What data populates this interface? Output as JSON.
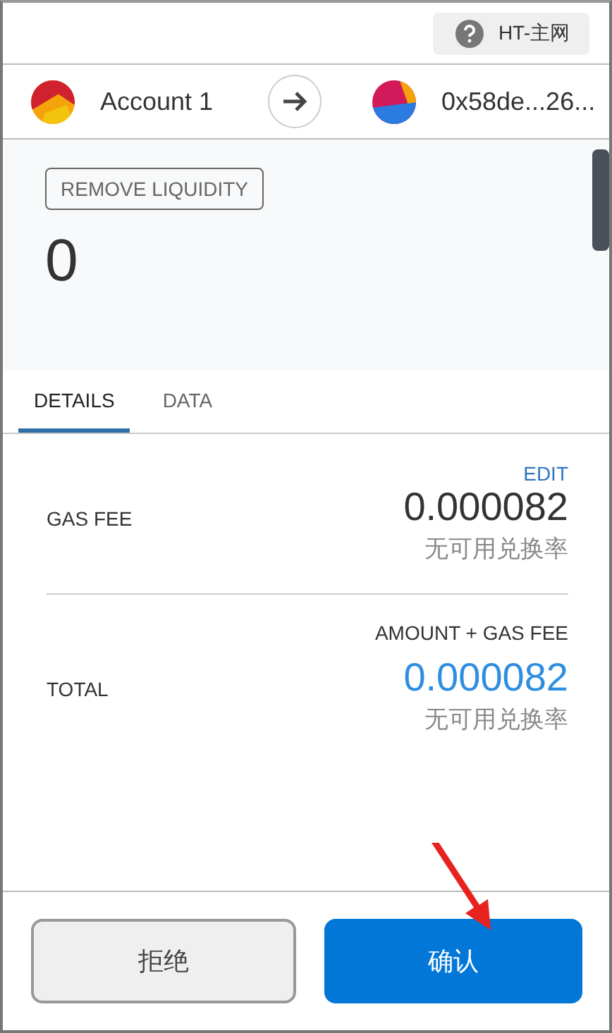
{
  "network": {
    "label": "HT-主网"
  },
  "sender": {
    "name": "Account 1"
  },
  "recipient": {
    "address": "0x58de...26..."
  },
  "method": {
    "label": "REMOVE LIQUIDITY"
  },
  "amount": "0",
  "tabs": [
    {
      "label": "DETAILS",
      "selected": true
    },
    {
      "label": "DATA",
      "selected": false
    }
  ],
  "edit_link": "EDIT",
  "gas_fee": {
    "label": "GAS FEE",
    "value": "0.000082",
    "note": "无可用兑换率"
  },
  "total": {
    "header": "AMOUNT + GAS FEE",
    "label": "TOTAL",
    "value": "0.000082",
    "note": "无可用兑换率"
  },
  "buttons": [
    {
      "label": "拒绝",
      "kind": "secondary"
    },
    {
      "label": "确认",
      "kind": "primary"
    }
  ]
}
